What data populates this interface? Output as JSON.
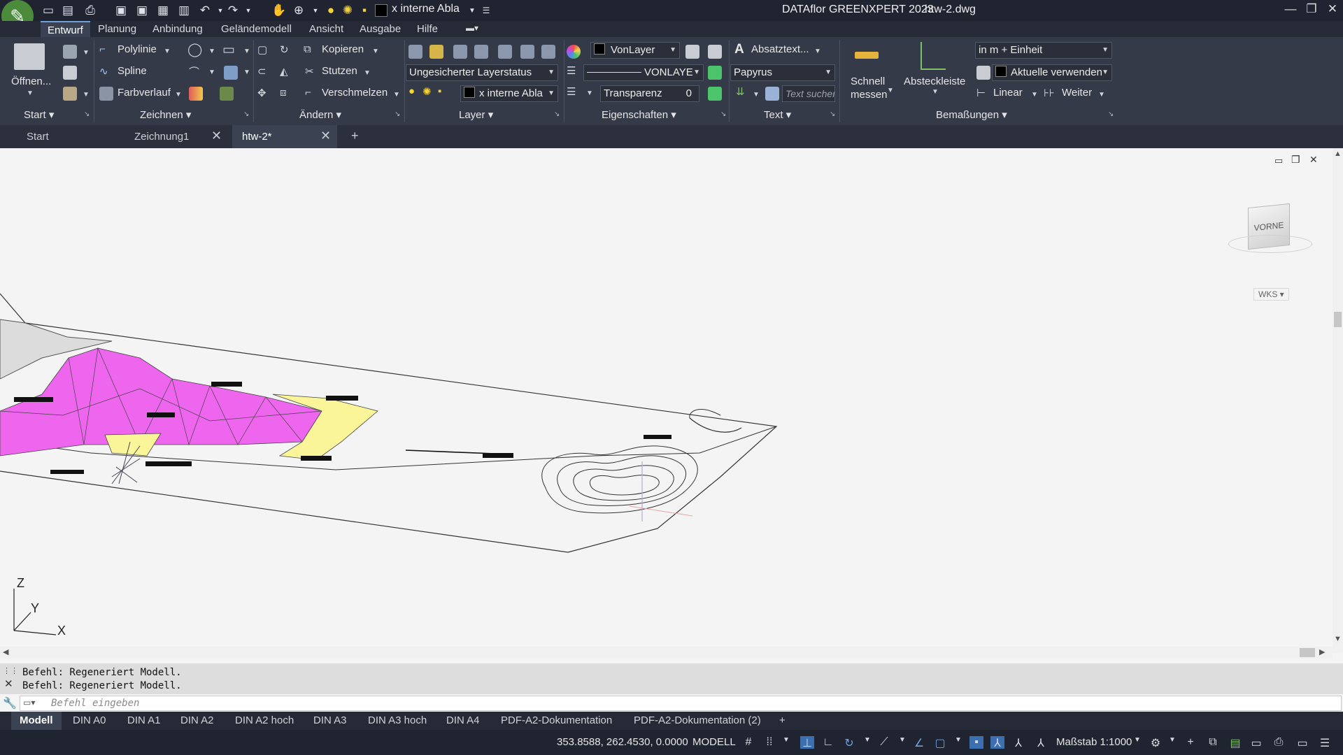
{
  "window": {
    "app_title": "DATAflor GREENXPERT 2023",
    "file_name": "htw-2.dwg",
    "layer_combo": "x interne Abla"
  },
  "menu": {
    "tabs": [
      "Entwurf",
      "Planung",
      "Anbindung",
      "Geländemodell",
      "Ansicht",
      "Ausgabe",
      "Hilfe"
    ],
    "active_tab": "Entwurf"
  },
  "ribbon": {
    "start": {
      "open_label": "Öffnen...",
      "section": "Start"
    },
    "zeichnen": {
      "polylinie": "Polylinie",
      "spline": "Spline",
      "farbverlauf": "Farbverlauf",
      "section": "Zeichnen"
    },
    "aendern": {
      "kopieren": "Kopieren",
      "stutzen": "Stutzen",
      "verschmelzen": "Verschmelzen",
      "section": "Ändern"
    },
    "layer": {
      "layerstatus": "Ungesicherter Layerstatus",
      "current_layer": "x interne Abla",
      "section": "Layer"
    },
    "eigenschaften": {
      "color": "VonLayer",
      "linetype": "VONLAYE",
      "transparency_label": "Transparenz",
      "transparency_value": "0",
      "section": "Eigenschaften"
    },
    "text": {
      "absatztext": "Absatztext...",
      "font": "Papyrus",
      "search_placeholder": "Text suchen",
      "section": "Text"
    },
    "bemassungen": {
      "schnell_line1": "Schnell",
      "schnell_line2": "messen",
      "abstecken": "Absteckleiste",
      "unit_combo": "in m + Einheit",
      "aktuelle": "Aktuelle verwenden",
      "linear": "Linear",
      "weiter": "Weiter",
      "section": "Bemaßungen"
    }
  },
  "doc_tabs": [
    {
      "label": "Start"
    },
    {
      "label": "Zeichnung1"
    },
    {
      "label": "htw-2*"
    }
  ],
  "viewport": {
    "viewcube_label": "VORNE",
    "ucs_label": "WKS",
    "axis_z": "Z",
    "axis_y": "Y",
    "axis_x": "X"
  },
  "command": {
    "history": [
      "Befehl:  Regeneriert Modell.",
      "Befehl:  Regeneriert Modell."
    ],
    "input_placeholder": "Befehl eingeben"
  },
  "layout_tabs": [
    "Modell",
    "DIN A0",
    "DIN A1",
    "DIN A2",
    "DIN A2 hoch",
    "DIN A3",
    "DIN A3 hoch",
    "DIN A4",
    "PDF-A2-Dokumentation",
    "PDF-A2-Dokumentation (2)"
  ],
  "status": {
    "coordinates": "353.8588, 262.4530, 0.0000",
    "mode": "MODELL",
    "scale": "Maßstab 1:1000"
  },
  "colors": {
    "magenta_fill": "#ee66ee",
    "yellow_fill": "#fbf59a",
    "accent": "#6f9fd8"
  }
}
